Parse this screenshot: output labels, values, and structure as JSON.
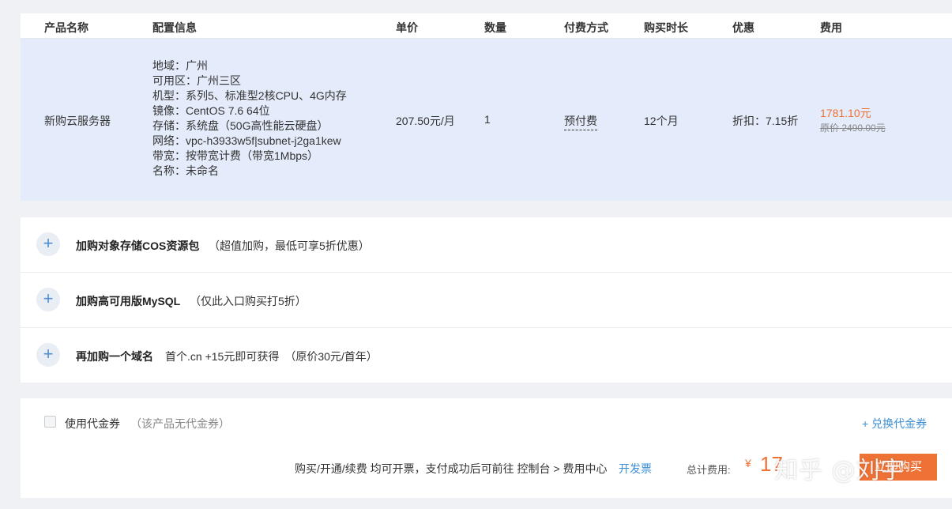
{
  "table": {
    "headers": [
      "产品名称",
      "配置信息",
      "单价",
      "数量",
      "付费方式",
      "购买时长",
      "优惠",
      "费用"
    ],
    "row": {
      "product": "新购云服务器",
      "specs": [
        "地域：广州",
        "可用区：广州三区",
        "机型：系列5、标准型2核CPU、4G内存",
        "镜像：CentOS 7.6 64位",
        "存储：系统盘（50G高性能云硬盘）",
        "网络：vpc-h3933w5f|subnet-j2ga1kew",
        "带宽：按带宽计费（带宽1Mbps）",
        "名称：未命名"
      ],
      "unit_price": "207.50元/月",
      "quantity": "1",
      "pay_mode": "预付费",
      "duration": "12个月",
      "discount": "折扣：7.15折",
      "fee": "1781.10元",
      "original_price": "原价 2490.00元"
    }
  },
  "addons": [
    {
      "title": "加购对象存储COS资源包",
      "desc": "（超值加购，最低可享5折优惠）"
    },
    {
      "title": "加购高可用版MySQL",
      "desc": "（仅此入口购买打5折）"
    },
    {
      "title": "再加购一个域名",
      "desc": "首个.cn +15元即可获得　（原价30元/首年）"
    }
  ],
  "voucher": {
    "label": "使用代金券",
    "note": "（该产品无代金券）",
    "redeem": "+ 兑换代金券"
  },
  "checkout": {
    "invoice_text": "购买/开通/续费 均可开票，支付成功后可前往 控制台 > 费用中心",
    "invoice_link": "开发票",
    "total_label": "总计费用:",
    "currency": "¥",
    "total": "17",
    "buy_button": "立即购买"
  },
  "watermark": "知乎 @刘宇",
  "colors": {
    "accent": "#ee7236",
    "link": "#3d8fd6",
    "row_highlight": "#e4ecfb"
  }
}
